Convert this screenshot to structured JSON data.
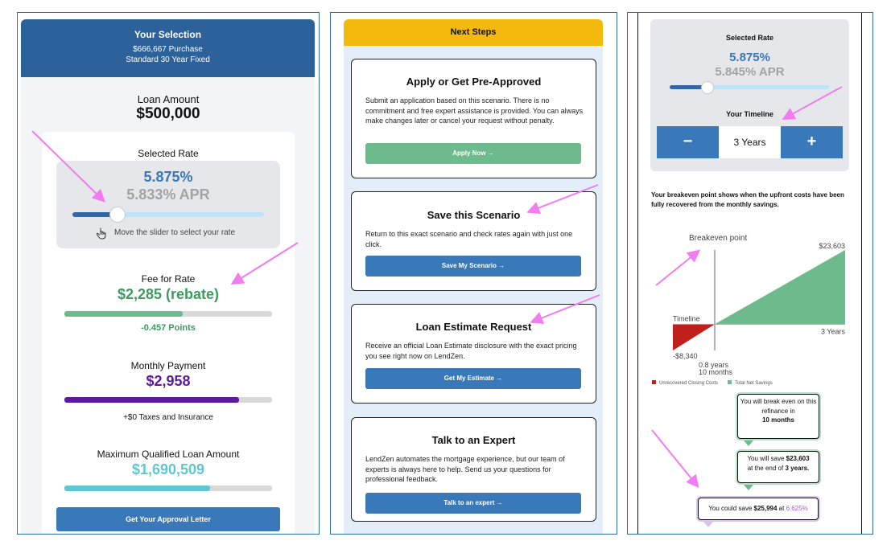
{
  "colors": {
    "header_blue": "#2d6199",
    "button_blue": "#3a79b9",
    "rate_blue": "#3b78b8",
    "apr_grey": "#a3a3a3",
    "fee_green": "#3f9a5f",
    "payment_purple": "#5b1aa0",
    "qualified_teal": "#5ec7cf",
    "next_steps_yellow": "#f4b90d",
    "apply_green": "#6dbb8c",
    "annotation_pink": "#f07cf0",
    "unrecovered_red": "#c0201c",
    "net_savings_green": "#6dbb8c",
    "rate_highlight_purple": "#a35ad6"
  },
  "selection": {
    "title": "Your Selection",
    "purchase": "$666,667 Purchase",
    "product": "Standard 30 Year Fixed",
    "loan_amount_label": "Loan Amount",
    "loan_amount": "$500,000",
    "selected_rate_label": "Selected Rate",
    "rate": "5.875%",
    "apr": "5.833% APR",
    "slider_level": 0.24,
    "slider_hint": "Move the slider to select your rate",
    "fee_label": "Fee for Rate",
    "fee_value": "$2,285 (rebate)",
    "fee_bar_fraction": 0.57,
    "points": "-0.457 Points",
    "monthly_label": "Monthly Payment",
    "monthly_value": "$2,958",
    "monthly_bar_fraction": 0.84,
    "taxes": "+$0 Taxes and Insurance",
    "max_label": "Maximum Qualified Loan Amount",
    "max_value": "$1,690,509",
    "max_bar_fraction": 0.7,
    "approval_button": "Get Your Approval Letter"
  },
  "next_steps": {
    "title": "Next Steps",
    "cards": [
      {
        "title": "Apply or Get Pre-Approved",
        "description": "Submit an application based on this scenario. There is no commitment and free expert assistance is provided. You can always make changes later or cancel your request without penalty.",
        "button": "Apply Now →"
      },
      {
        "title": "Save this Scenario",
        "description": "Return to this exact scenario and check rates again with just one click.",
        "button": "Save My Scenario →"
      },
      {
        "title": "Loan Estimate Request",
        "description": "Receive an official Loan Estimate disclosure with the exact pricing you see right now on LendZen.",
        "button": "Get My Estimate →"
      },
      {
        "title": "Talk to an Expert",
        "description": "LendZen automates the mortgage experience, but our team of experts is always here to help. Send us your questions for professional feedback.",
        "button": "Talk to an expert →"
      }
    ]
  },
  "refinance": {
    "selected_rate_label": "Selected Rate",
    "rate": "5.875%",
    "apr": "5.845% APR",
    "slider_level": 0.24,
    "timeline_label": "Your Timeline",
    "minus_symbol": "−",
    "plus_symbol": "+",
    "timeline_value": "3 Years",
    "breakeven_text": "Your breakeven point shows when the upfront costs have been fully recovered from the monthly savings.",
    "bubbles": {
      "b1_pre": "You will break even on this refinance in",
      "b1_bold": "10 months",
      "b2_pre": "You will save",
      "b2_amount": "$23,603",
      "b2_mid": "at the end of",
      "b2_years": "3 years.",
      "b3_pre": "You could save",
      "b3_amount": "$25,994",
      "b3_mid": "at",
      "b3_rate": "6.625%"
    }
  },
  "chart_data": {
    "type": "area",
    "title": "Breakeven point",
    "x_start_label": "Timeline",
    "x_end_label": "3 Years",
    "breakeven_label_1": "0.8 years",
    "breakeven_label_2": "10 months",
    "breakeven_years": 0.8,
    "x_range": [
      0,
      3
    ],
    "y_min_label": "-$8,340",
    "y_max_label": "$23,603",
    "y_min": -8340,
    "y_max": 23603,
    "series": [
      {
        "name": "Unrecovered Closing Costs",
        "points": [
          [
            0,
            -8340
          ],
          [
            0.8,
            0
          ]
        ],
        "color": "#c0201c"
      },
      {
        "name": "Total Net Savings",
        "points": [
          [
            0.8,
            0
          ],
          [
            3,
            23603
          ]
        ],
        "color": "#6dbb8c"
      }
    ],
    "legend_position": "bottom-left"
  }
}
